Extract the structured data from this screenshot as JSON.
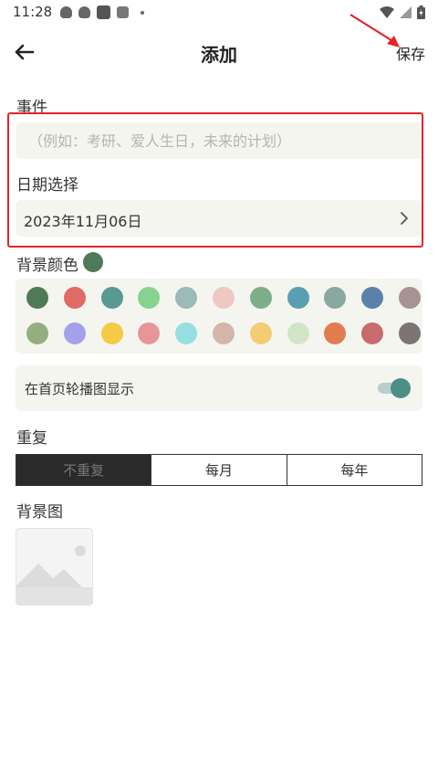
{
  "status_bar": {
    "time": "11:28",
    "left_icons": [
      "qq-icon",
      "qq-icon",
      "app-icon",
      "a-icon"
    ],
    "right_icons": [
      "wifi-icon",
      "signal-icon",
      "battery-icon"
    ]
  },
  "header": {
    "title": "添加",
    "save_label": "保存",
    "back_icon": "arrow-left-icon"
  },
  "event": {
    "label": "事件",
    "value": "",
    "placeholder": "（例如：考研、爱人生日，未来的计划）"
  },
  "date": {
    "label": "日期选择",
    "value": "2023年11月06日",
    "icon": "chevron-right-icon"
  },
  "background_color": {
    "label": "背景颜色",
    "selected": "#4e7a58",
    "palette": [
      [
        "#4e7a58",
        "#df6a66",
        "#589a92",
        "#86d28e",
        "#9bbab9",
        "#f0c8c2",
        "#7dae88",
        "#5a9fb0",
        "#8aa8a2",
        "#5a82a8",
        "#a89293"
      ],
      [
        "#94ae80",
        "#a5a0ec",
        "#f4ca46",
        "#e8959a",
        "#96dfe1",
        "#d3b6a8",
        "#f2cd74",
        "#d1e6c5",
        "#e07c4e",
        "#c86a6e",
        "#7c7474"
      ]
    ]
  },
  "carousel_toggle": {
    "label": "在首页轮播图显示",
    "on": true,
    "accent": "#4b8f86"
  },
  "repeat": {
    "label": "重复",
    "options": [
      "不重复",
      "每月",
      "每年"
    ],
    "selected_index": 0
  },
  "background_image": {
    "label": "背景图",
    "icon": "image-placeholder-icon"
  },
  "colors": {
    "highlight_border": "#e5232b",
    "field_bg": "#f5f5f0"
  }
}
